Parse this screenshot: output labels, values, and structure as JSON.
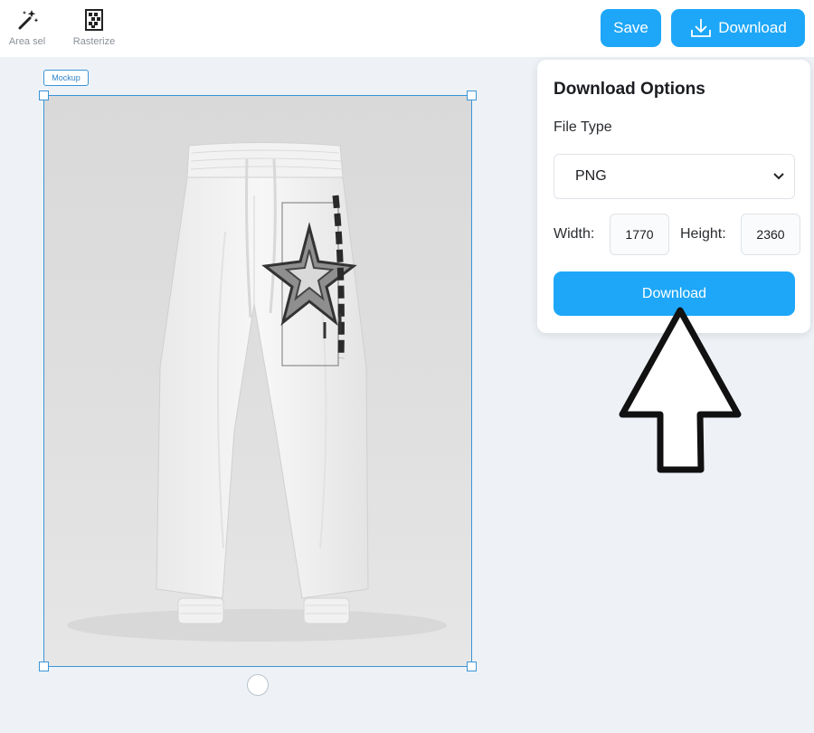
{
  "toolbar": {
    "tools": [
      {
        "label": "Area sel",
        "icon": "magic-wand-icon"
      },
      {
        "label": "Rasterize",
        "icon": "rasterize-icon"
      }
    ],
    "save_label": "Save",
    "download_label": "Download"
  },
  "canvas": {
    "layer_tag": "Mockup"
  },
  "download_panel": {
    "title": "Download Options",
    "file_type_label": "File Type",
    "file_type_value": "PNG",
    "width_label": "Width:",
    "width_value": "1770",
    "height_label": "Height:",
    "height_value": "2360",
    "download_button": "Download"
  },
  "colors": {
    "accent": "#1ea7f8",
    "selection": "#3a95d7",
    "canvas_bg": "#eef2f6"
  }
}
